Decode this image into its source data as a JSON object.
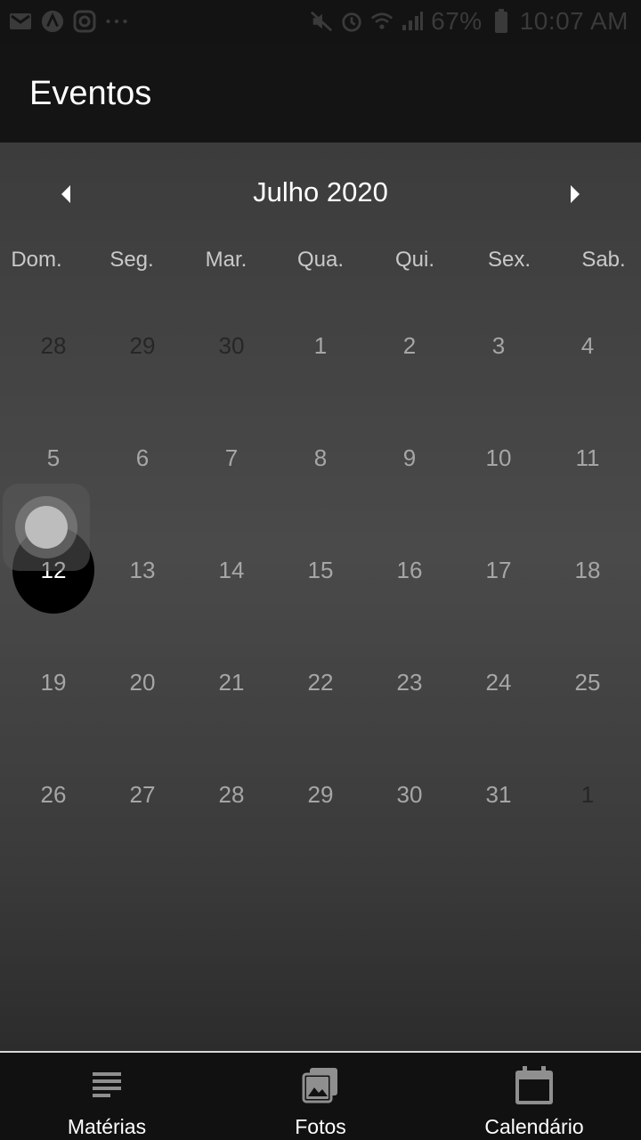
{
  "status_bar": {
    "battery": "67%",
    "time": "10:07 AM"
  },
  "app_bar": {
    "title": "Eventos"
  },
  "calendar": {
    "month_title": "Julho 2020",
    "weekdays": [
      "Dom.",
      "Seg.",
      "Mar.",
      "Qua.",
      "Qui.",
      "Sex.",
      "Sab."
    ],
    "selected_day": "12",
    "weeks": [
      [
        {
          "d": "28",
          "muted": true
        },
        {
          "d": "29",
          "muted": true
        },
        {
          "d": "30",
          "muted": true
        },
        {
          "d": "1"
        },
        {
          "d": "2"
        },
        {
          "d": "3"
        },
        {
          "d": "4"
        }
      ],
      [
        {
          "d": "5"
        },
        {
          "d": "6"
        },
        {
          "d": "7"
        },
        {
          "d": "8"
        },
        {
          "d": "9"
        },
        {
          "d": "10"
        },
        {
          "d": "11"
        }
      ],
      [
        {
          "d": "12",
          "selected": true
        },
        {
          "d": "13"
        },
        {
          "d": "14"
        },
        {
          "d": "15"
        },
        {
          "d": "16"
        },
        {
          "d": "17"
        },
        {
          "d": "18"
        }
      ],
      [
        {
          "d": "19"
        },
        {
          "d": "20"
        },
        {
          "d": "21"
        },
        {
          "d": "22"
        },
        {
          "d": "23"
        },
        {
          "d": "24"
        },
        {
          "d": "25"
        }
      ],
      [
        {
          "d": "26"
        },
        {
          "d": "27"
        },
        {
          "d": "28"
        },
        {
          "d": "29"
        },
        {
          "d": "30"
        },
        {
          "d": "31"
        },
        {
          "d": "1",
          "muted": true
        }
      ]
    ]
  },
  "bottom_nav": {
    "items": [
      {
        "label": "Matérias",
        "icon": "list-icon"
      },
      {
        "label": "Fotos",
        "icon": "photos-icon"
      },
      {
        "label": "Calendário",
        "icon": "calendar-icon"
      }
    ]
  },
  "colors": {
    "app_bar": "#141414",
    "selected_day": "#000000",
    "day_text": "#a6a6a6"
  }
}
